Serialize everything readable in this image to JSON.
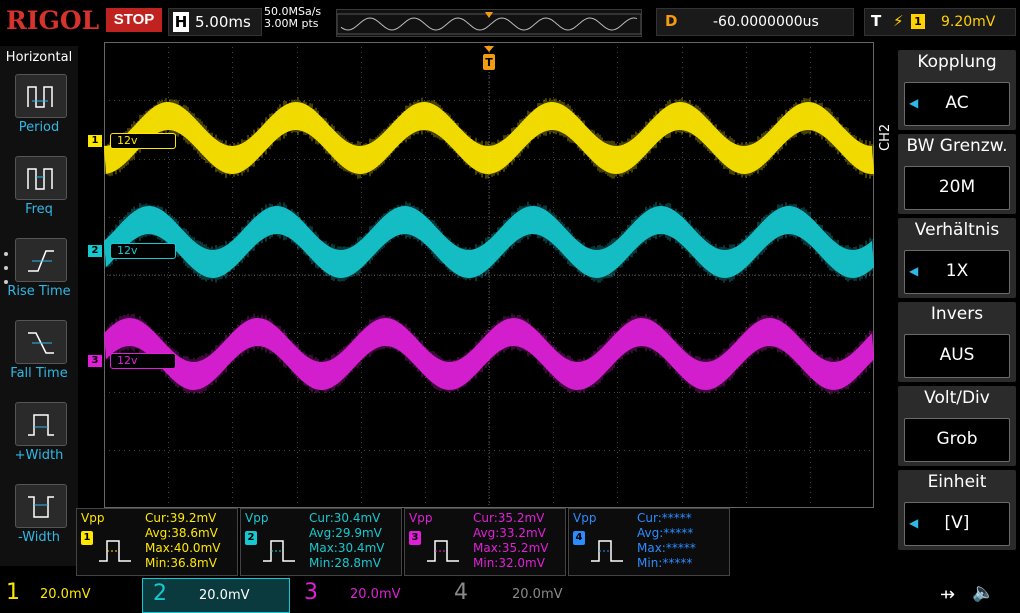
{
  "header": {
    "brand": "RIGOL",
    "run_state": "STOP",
    "timebase_label": "H",
    "timebase_value": "5.00ms",
    "sample_rate": "50.0MSa/s",
    "memory_depth": "3.00M pts",
    "delay_label": "D",
    "delay_value": "-60.0000000us",
    "trigger_label": "T",
    "trigger_source": "1",
    "trigger_level": "9.20mV"
  },
  "left_menu": {
    "title": "Horizontal",
    "items": [
      {
        "label": "Period",
        "icon": "period-icon"
      },
      {
        "label": "Freq",
        "icon": "frequency-icon"
      },
      {
        "label": "Rise Time",
        "icon": "rise-time-icon"
      },
      {
        "label": "Fall Time",
        "icon": "fall-time-icon"
      },
      {
        "label": "+Width",
        "icon": "positive-width-icon"
      },
      {
        "label": "-Width",
        "icon": "negative-width-icon"
      }
    ]
  },
  "right_menu": {
    "channel_tab": "CH2",
    "items": [
      {
        "title": "Kopplung",
        "value": "AC",
        "arrow": true
      },
      {
        "title": "BW Grenzw.",
        "value": "20M",
        "arrow": false
      },
      {
        "title": "Verhältnis",
        "value": "1X",
        "arrow": true
      },
      {
        "title": "Invers",
        "value": "AUS",
        "arrow": false
      },
      {
        "title": "Volt/Div",
        "value": "Grob",
        "arrow": false
      },
      {
        "title": "Einheit",
        "value": "[V]",
        "arrow": true
      }
    ]
  },
  "channels": [
    {
      "num": "1",
      "marker_label": "12v",
      "color": "#ffe800"
    },
    {
      "num": "2",
      "marker_label": "12v",
      "color": "#16c8d0"
    },
    {
      "num": "3",
      "marker_label": "12v",
      "color": "#e020d8"
    }
  ],
  "measurements": [
    {
      "type": "Vpp",
      "channel": "1",
      "color": "#ffe800",
      "cur": "Cur:39.2mV",
      "avg": "Avg:38.6mV",
      "max": "Max:40.0mV",
      "min": "Min:36.8mV"
    },
    {
      "type": "Vpp",
      "channel": "2",
      "color": "#16c8d0",
      "cur": "Cur:30.4mV",
      "avg": "Avg:29.9mV",
      "max": "Max:30.4mV",
      "min": "Min:28.8mV"
    },
    {
      "type": "Vpp",
      "channel": "3",
      "color": "#e020d8",
      "cur": "Cur:35.2mV",
      "avg": "Avg:33.2mV",
      "max": "Max:35.2mV",
      "min": "Min:32.0mV"
    },
    {
      "type": "Vpp",
      "channel": "4",
      "color": "#2b8cff",
      "cur": "Cur:*****",
      "avg": "Avg:*****",
      "max": "Max:*****",
      "min": "Min:*****"
    }
  ],
  "bottom_bar": {
    "ch1": {
      "num": "1",
      "scale": "20.0mV",
      "color": "#ffe800"
    },
    "ch2": {
      "num": "2",
      "scale": "20.0mV",
      "color": "#16c8d0"
    },
    "ch3": {
      "num": "3",
      "scale": "20.0mV",
      "color": "#e020d8"
    },
    "ch4": {
      "num": "4",
      "scale": "20.0mV",
      "color": "#8a8a8a"
    }
  },
  "colors": {
    "ch1": "#ffe800",
    "ch2": "#16c8d0",
    "ch3": "#e020d8",
    "ch4": "#2b8cff",
    "accent": "#2eb8e6",
    "trigger": "#f39c12"
  }
}
